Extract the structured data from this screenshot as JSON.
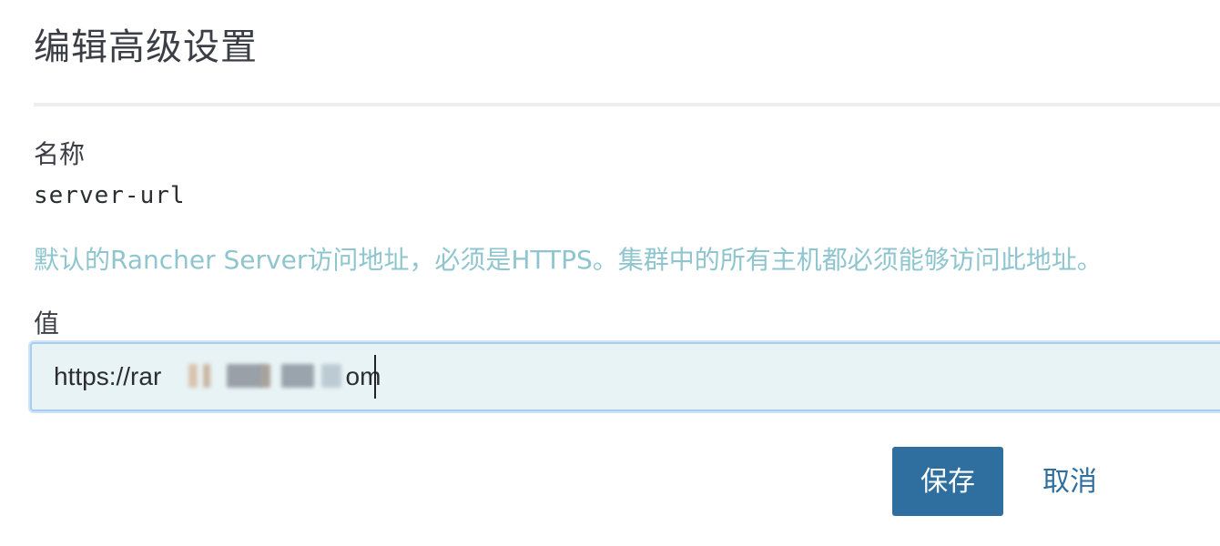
{
  "dialog": {
    "title": "编辑高级设置",
    "name_label": "名称",
    "name_value": "server-url",
    "help_text": "默认的Rancher Server访问地址，必须是HTTPS。集群中的所有主机都必须能够访问此地址。",
    "value_label": "值",
    "input_value": "https://rar                          om",
    "save_label": "保存",
    "cancel_label": "取消"
  },
  "colors": {
    "primary": "#2f6fa0",
    "help_text": "#8fc5cf",
    "input_bg": "#e8f3f5",
    "input_border": "#a8cdf0"
  }
}
